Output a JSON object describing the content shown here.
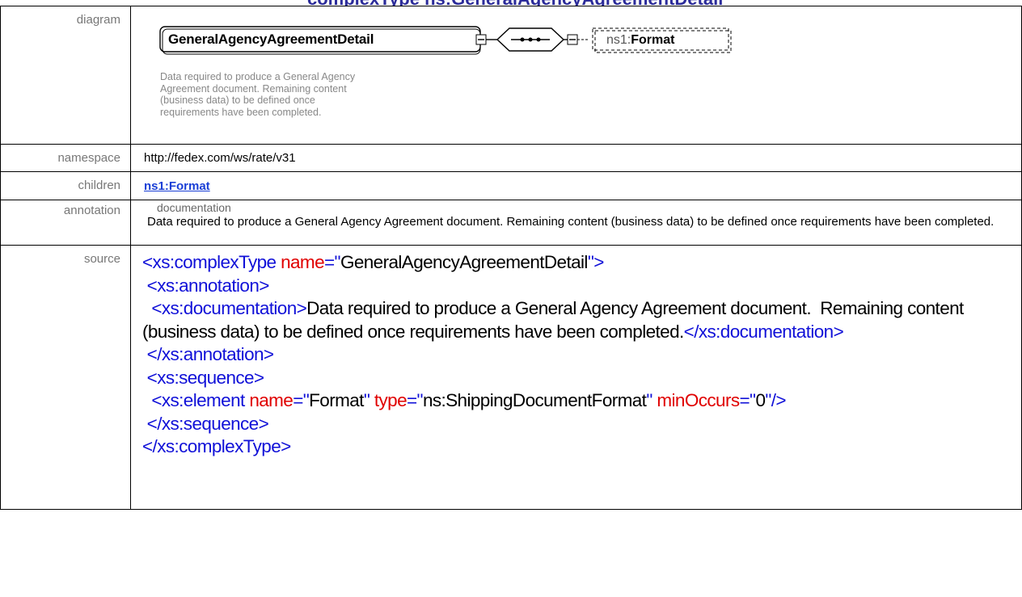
{
  "header_partial": "complexType ns:GeneralAgencyAgreementDetail",
  "rows": {
    "diagram": {
      "label": "diagram",
      "node_name": "GeneralAgencyAgreementDetail",
      "child_name": "ns1:Format",
      "description_lines": [
        "Data required to produce a General Agency",
        "Agreement document. Remaining content",
        "(business data) to be defined once",
        "requirements have been completed."
      ]
    },
    "namespace": {
      "label": "namespace",
      "value": "http://fedex.com/ws/rate/v31"
    },
    "children": {
      "label": "children",
      "link": "ns1:Format"
    },
    "annotation": {
      "label": "annotation",
      "heading": "documentation",
      "text": "Data required to produce a General Agency Agreement document.  Remaining content (business data) to be defined once requirements have been completed."
    },
    "source": {
      "label": "source",
      "complex_open_tag": "<xs:complexType",
      "name_attr": "name",
      "name_value": "GeneralAgencyAgreementDetail",
      "annotation_open": "<xs:annotation>",
      "documentation_open": "<xs:documentation>",
      "documentation_text": "Data required to produce a General Agency Agreement document.  Remaining content (business data) to be defined once requirements have been completed.",
      "documentation_close": "</xs:documentation>",
      "annotation_close": "</xs:annotation>",
      "sequence_open": "<xs:sequence>",
      "element_open": "<xs:element",
      "element_name_value": "Format",
      "type_attr": "type",
      "type_value": "ns:ShippingDocumentFormat",
      "minoccurs_attr": "minOccurs",
      "minoccurs_value": "0",
      "sequence_close": "</xs:sequence>",
      "complex_close": "</xs:complexType>"
    }
  }
}
